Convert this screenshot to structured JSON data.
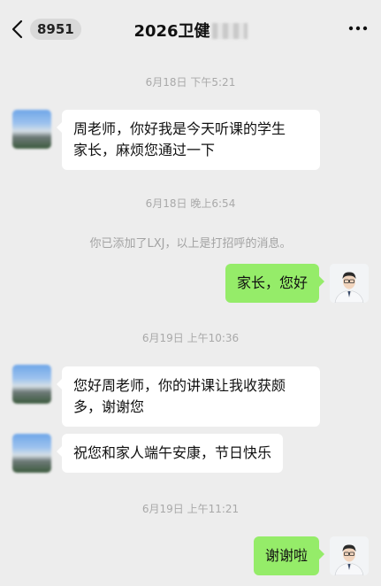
{
  "header": {
    "back_badge": "8951",
    "title": "2026卫健"
  },
  "messages": [
    {
      "kind": "time",
      "text": "6月18日 下午5:21"
    },
    {
      "kind": "in",
      "text_line1": "周老师，你好我是今天听课的学生",
      "text_line2": "家长，麻烦您通过一下"
    },
    {
      "kind": "time",
      "text": "6月18日 晚上6:54"
    },
    {
      "kind": "system",
      "text": "你已添加了LXJ，以上是打招呼的消息。"
    },
    {
      "kind": "out",
      "text": "家长，您好"
    },
    {
      "kind": "time",
      "text": "6月19日 上午10:36"
    },
    {
      "kind": "in",
      "text_line1": "您好周老师，你的讲课让我收获颇",
      "text_line2": "多，谢谢您"
    },
    {
      "kind": "in",
      "text": "祝您和家人端午安康，节日快乐"
    },
    {
      "kind": "time",
      "text": "6月19日 上午11:21"
    },
    {
      "kind": "out",
      "text": "谢谢啦"
    }
  ],
  "colors": {
    "background": "#ededed",
    "outgoing_bubble": "#95ec69",
    "incoming_bubble": "#ffffff"
  },
  "icons": [
    "back-chevron-icon",
    "more-dots-icon"
  ]
}
